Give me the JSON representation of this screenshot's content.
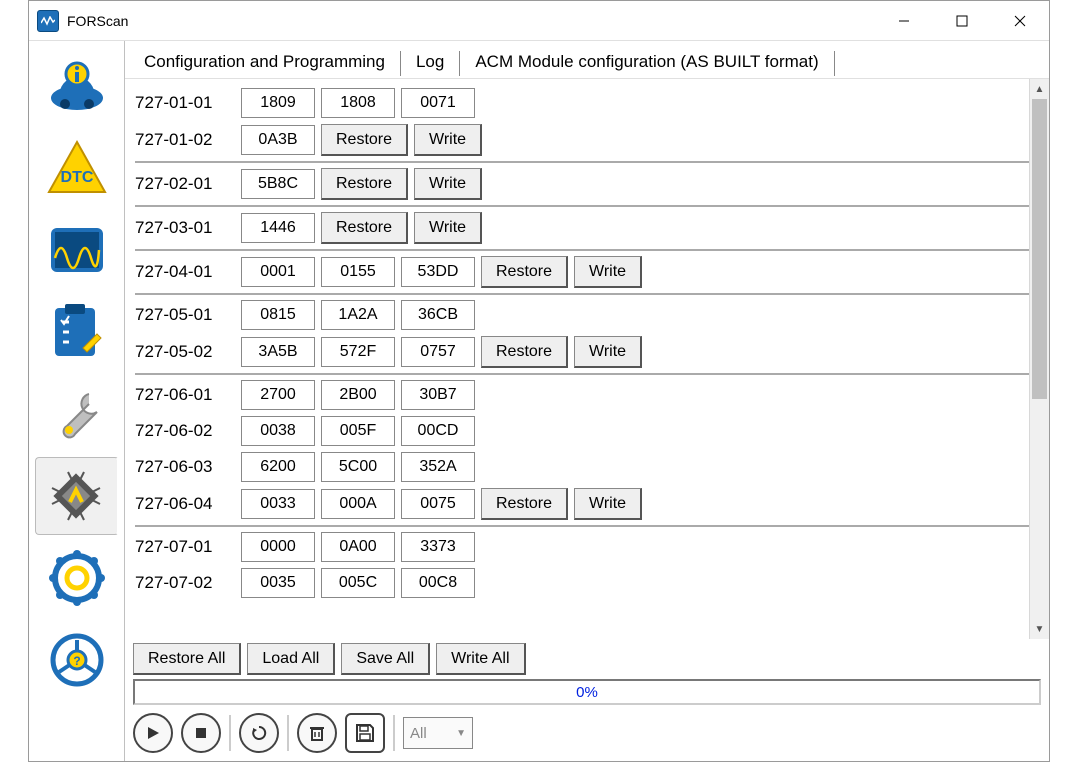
{
  "window": {
    "title": "FORScan"
  },
  "tabs": {
    "config": "Configuration and Programming",
    "log": "Log",
    "current": "ACM Module configuration (AS BUILT format)"
  },
  "buttons": {
    "restore": "Restore",
    "write": "Write",
    "restoreAll": "Restore All",
    "loadAll": "Load All",
    "saveAll": "Save All",
    "writeAll": "Write All"
  },
  "progress": "0%",
  "select": {
    "value": "All"
  },
  "rows": [
    {
      "label": "727-01-01",
      "fields": [
        "1809",
        "1808",
        "0071"
      ],
      "btns": false,
      "divider": false
    },
    {
      "label": "727-01-02",
      "fields": [
        "0A3B"
      ],
      "btns": true,
      "divider": true
    },
    {
      "label": "727-02-01",
      "fields": [
        "5B8C"
      ],
      "btns": true,
      "divider": true
    },
    {
      "label": "727-03-01",
      "fields": [
        "1446"
      ],
      "btns": true,
      "divider": true
    },
    {
      "label": "727-04-01",
      "fields": [
        "0001",
        "0155",
        "53DD"
      ],
      "btns": true,
      "divider": true
    },
    {
      "label": "727-05-01",
      "fields": [
        "0815",
        "1A2A",
        "36CB"
      ],
      "btns": false,
      "divider": false
    },
    {
      "label": "727-05-02",
      "fields": [
        "3A5B",
        "572F",
        "0757"
      ],
      "btns": true,
      "divider": true
    },
    {
      "label": "727-06-01",
      "fields": [
        "2700",
        "2B00",
        "30B7"
      ],
      "btns": false,
      "divider": false
    },
    {
      "label": "727-06-02",
      "fields": [
        "0038",
        "005F",
        "00CD"
      ],
      "btns": false,
      "divider": false
    },
    {
      "label": "727-06-03",
      "fields": [
        "6200",
        "5C00",
        "352A"
      ],
      "btns": false,
      "divider": false
    },
    {
      "label": "727-06-04",
      "fields": [
        "0033",
        "000A",
        "0075"
      ],
      "btns": true,
      "divider": true
    },
    {
      "label": "727-07-01",
      "fields": [
        "0000",
        "0A00",
        "3373"
      ],
      "btns": false,
      "divider": false
    },
    {
      "label": "727-07-02",
      "fields": [
        "0035",
        "005C",
        "00C8"
      ],
      "btns": false,
      "divider": false
    }
  ]
}
